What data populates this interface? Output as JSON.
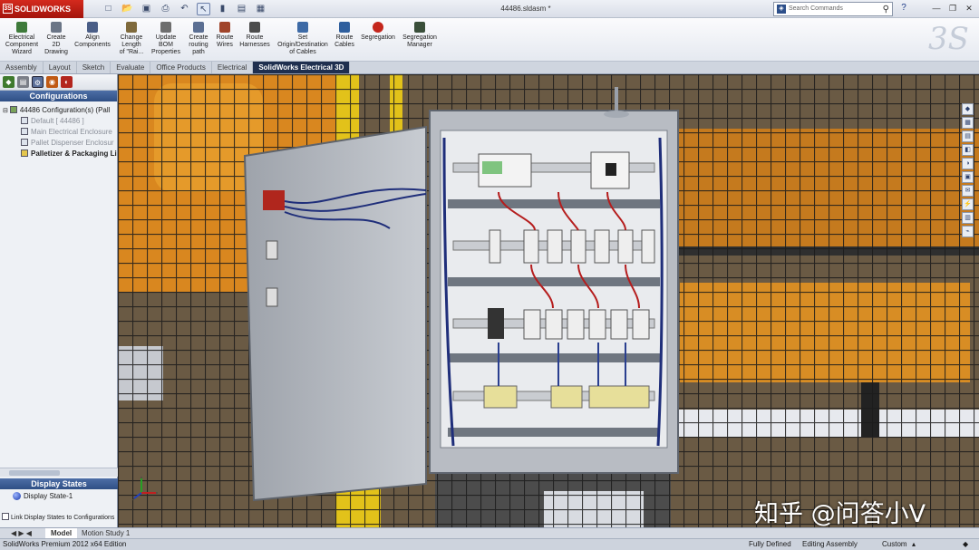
{
  "app": {
    "logo": "SOLIDWORKS",
    "document_title": "44486.sldasm *"
  },
  "search": {
    "placeholder": "Search Commands"
  },
  "ribbon": {
    "buttons": [
      {
        "label": "Electrical\nComponent\nWizard"
      },
      {
        "label": "Create\n2D\nDrawing"
      },
      {
        "label": "Align\nComponents"
      },
      {
        "label": "Change\nLength\nof \"Rai..."
      },
      {
        "label": "Update\nBOM\nProperties"
      },
      {
        "label": "Create\nrouting\npath"
      },
      {
        "label": "Route\nWires"
      },
      {
        "label": "Route\nHarnesses"
      },
      {
        "label": "Set\nOrigin/Destination\nof Cables"
      },
      {
        "label": "Route\nCables"
      },
      {
        "label": "Segregation"
      },
      {
        "label": "Segregation\nManager"
      }
    ]
  },
  "tabs": [
    "Assembly",
    "Layout",
    "Sketch",
    "Evaluate",
    "Office Products",
    "Electrical",
    "SolidWorks Electrical 3D"
  ],
  "active_tab": "SolidWorks Electrical 3D",
  "left_pane": {
    "header": "Configurations",
    "tree": [
      {
        "label": "44486 Configuration(s)  (Pall"
      },
      {
        "label": "Default [ 44486 ]"
      },
      {
        "label": "Main Electrical Enclosure"
      },
      {
        "label": "Pallet Dispenser Enclosur"
      },
      {
        "label": "Palletizer & Packaging Li"
      }
    ],
    "display_states_header": "Display States",
    "display_state": "Display State-1",
    "link_checkbox_label": "Link Display States to Configurations"
  },
  "bottom_tabs": [
    "Model",
    "Motion Study 1"
  ],
  "status": {
    "edition": "SolidWorks Premium 2012 x64 Edition",
    "definition": "Fully Defined",
    "mode": "Editing Assembly",
    "units": "Custom"
  },
  "watermark": "知乎 @问答小V",
  "colors": {
    "title_red": "#c21f14",
    "active_tab": "#1f2f4f",
    "header_blue": "#3b5b94"
  }
}
